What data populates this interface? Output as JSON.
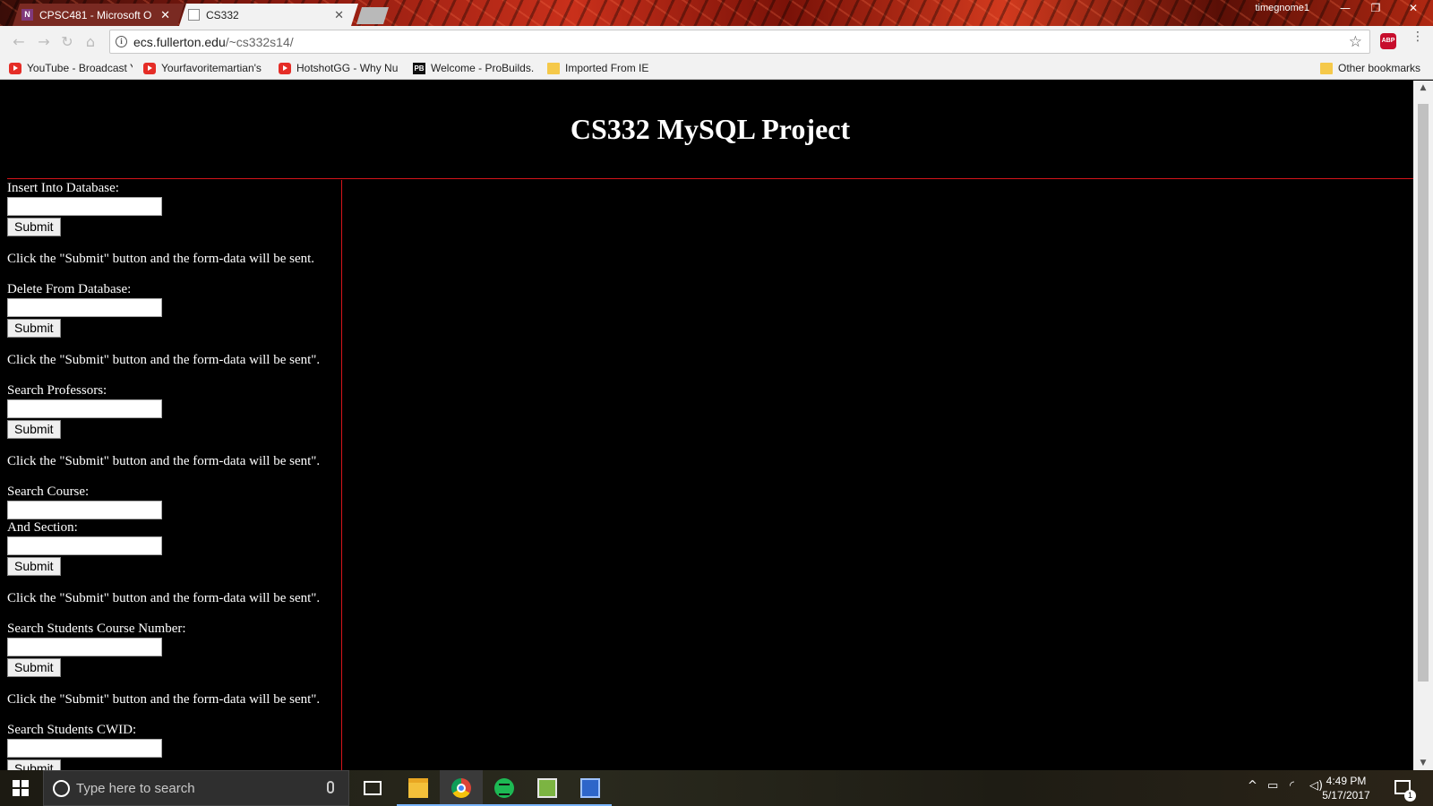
{
  "browser": {
    "tabs": [
      {
        "label": "CPSC481 - Microsoft O",
        "icon": "onenote-icon",
        "active": false
      },
      {
        "label": "CS332",
        "icon": "document-icon",
        "active": true
      }
    ],
    "tab_close_glyph": "✕",
    "user_name": "timegnome1",
    "url_host": "ecs.fullerton.edu",
    "url_path": "/~cs332s14/",
    "abp_label": "ABP",
    "bookmarks": [
      {
        "label": "YouTube - Broadcast Y",
        "icon": "youtube-icon"
      },
      {
        "label": "Yourfavoritemartian's",
        "icon": "youtube-icon"
      },
      {
        "label": "HotshotGG - Why Nu",
        "icon": "youtube-icon"
      },
      {
        "label": "Welcome - ProBuilds.",
        "icon": "probuilds-icon"
      },
      {
        "label": "Imported From IE",
        "icon": "folder-icon"
      }
    ],
    "other_bookmarks": "Other bookmarks"
  },
  "page": {
    "title": "CS332 MySQL Project",
    "forms": [
      {
        "fields": [
          "Insert Into Database:"
        ],
        "button": "Submit",
        "note": "Click the \"Submit\" button and the form-data will be sent."
      },
      {
        "fields": [
          "Delete From Database:"
        ],
        "button": "Submit",
        "note": "Click the \"Submit\" button and the form-data will be sent\"."
      },
      {
        "fields": [
          "Search Professors:"
        ],
        "button": "Submit",
        "note": "Click the \"Submit\" button and the form-data will be sent\"."
      },
      {
        "fields": [
          "Search Course:",
          "And Section:"
        ],
        "button": "Submit",
        "note": "Click the \"Submit\" button and the form-data will be sent\"."
      },
      {
        "fields": [
          "Search Students Course Number:"
        ],
        "button": "Submit",
        "note": "Click the \"Submit\" button and the form-data will be sent\"."
      },
      {
        "fields": [
          "Search Students CWID:"
        ],
        "button": "Submit",
        "note": ""
      }
    ]
  },
  "taskbar": {
    "search_placeholder": "Type here to search",
    "apps": [
      "file-explorer-icon",
      "chrome-icon",
      "spotify-icon",
      "notepad-icon",
      "network-icon"
    ],
    "time": "4:49 PM",
    "date": "5/17/2017",
    "notification_count": "1"
  },
  "colors": {
    "page_background": "#000000",
    "divider": "#d4141a",
    "text": "#ffffff"
  }
}
